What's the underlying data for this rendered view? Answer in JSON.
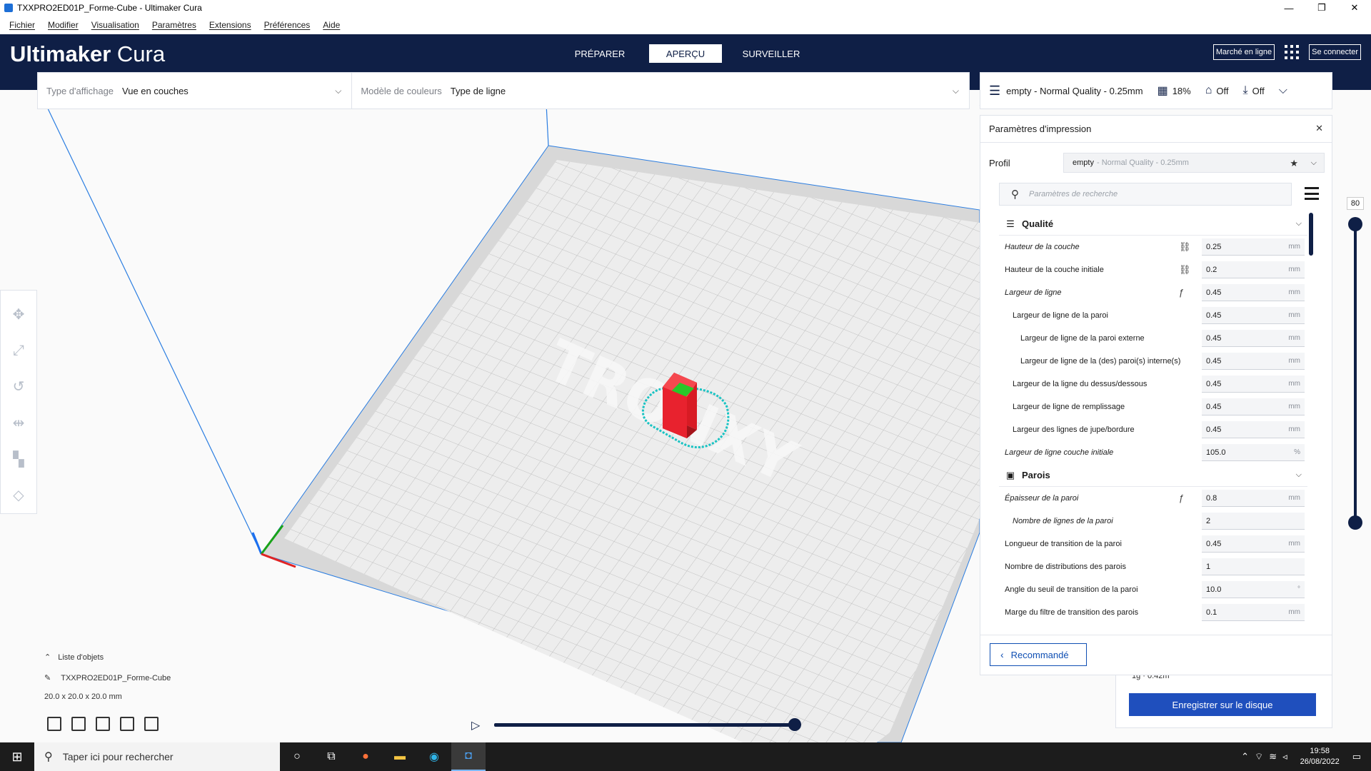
{
  "window": {
    "title": "TXXPRO2ED01P_Forme-Cube - Ultimaker Cura",
    "minimize": "—",
    "maximize": "❐",
    "close": "✕"
  },
  "menu": [
    "Fichier",
    "Modifier",
    "Visualisation",
    "Paramètres",
    "Extensions",
    "Préférences",
    "Aide"
  ],
  "header": {
    "logo_bold": "Ultimaker",
    "logo_light": "Cura",
    "stages": [
      "PRÉPARER",
      "APERÇU",
      "SURVEILLER"
    ],
    "active_stage": "APERÇU",
    "marketplace": "Marché en ligne",
    "signin": "Se connecter"
  },
  "view": {
    "type_label": "Type d'affichage",
    "type_value": "Vue en couches",
    "color_label": "Modèle de couleurs",
    "color_value": "Type de ligne"
  },
  "print_setup": {
    "profile": "empty - Normal Quality - 0.25mm",
    "infill": "18%",
    "support": "Off",
    "adhesion": "Off"
  },
  "panel": {
    "title": "Paramètres d'impression",
    "profile_label": "Profil",
    "profile_name": "empty",
    "profile_sub": "- Normal Quality - 0.25mm",
    "search_placeholder": "Paramètres de recherche",
    "recommended": "Recommandé"
  },
  "categories": [
    {
      "name": "Qualité",
      "icon": "quality-icon",
      "settings": [
        {
          "label": "Hauteur de la couche",
          "value": "0.25",
          "unit": "mm",
          "indent": 0,
          "italic": true,
          "icon": "link-icon"
        },
        {
          "label": "Hauteur de la couche initiale",
          "value": "0.2",
          "unit": "mm",
          "indent": 0,
          "italic": false,
          "icon": "link-icon"
        },
        {
          "label": "Largeur de ligne",
          "value": "0.45",
          "unit": "mm",
          "indent": 0,
          "italic": true,
          "icon": "function-icon"
        },
        {
          "label": "Largeur de ligne de la paroi",
          "value": "0.45",
          "unit": "mm",
          "indent": 1,
          "italic": false,
          "icon": ""
        },
        {
          "label": "Largeur de ligne de la paroi externe",
          "value": "0.45",
          "unit": "mm",
          "indent": 2,
          "italic": false,
          "icon": ""
        },
        {
          "label": "Largeur de ligne de la (des) paroi(s) interne(s)",
          "value": "0.45",
          "unit": "mm",
          "indent": 2,
          "italic": false,
          "icon": ""
        },
        {
          "label": "Largeur de la ligne du dessus/dessous",
          "value": "0.45",
          "unit": "mm",
          "indent": 1,
          "italic": false,
          "icon": ""
        },
        {
          "label": "Largeur de ligne de remplissage",
          "value": "0.45",
          "unit": "mm",
          "indent": 1,
          "italic": false,
          "icon": ""
        },
        {
          "label": "Largeur des lignes de jupe/bordure",
          "value": "0.45",
          "unit": "mm",
          "indent": 1,
          "italic": false,
          "icon": ""
        },
        {
          "label": "Largeur de ligne couche initiale",
          "value": "105.0",
          "unit": "%",
          "indent": 0,
          "italic": true,
          "icon": ""
        }
      ]
    },
    {
      "name": "Parois",
      "icon": "walls-icon",
      "settings": [
        {
          "label": "Épaisseur de la paroi",
          "value": "0.8",
          "unit": "mm",
          "indent": 0,
          "italic": true,
          "icon": "function-icon"
        },
        {
          "label": "Nombre de lignes de la paroi",
          "value": "2",
          "unit": "",
          "indent": 1,
          "italic": true,
          "icon": ""
        },
        {
          "label": "Longueur de transition de la paroi",
          "value": "0.45",
          "unit": "mm",
          "indent": 0,
          "italic": false,
          "icon": ""
        },
        {
          "label": "Nombre de distributions des parois",
          "value": "1",
          "unit": "",
          "indent": 0,
          "italic": false,
          "icon": ""
        },
        {
          "label": "Angle du seuil de transition de la paroi",
          "value": "10.0",
          "unit": "°",
          "indent": 0,
          "italic": false,
          "icon": ""
        },
        {
          "label": "Marge du filtre de transition des parois",
          "value": "0.1",
          "unit": "mm",
          "indent": 0,
          "italic": false,
          "icon": ""
        }
      ]
    }
  ],
  "objects": {
    "header": "Liste d'objets",
    "name": "TXXPRO2ED01P_Forme-Cube",
    "dims": "20.0 x 20.0 x 20.0 mm"
  },
  "layer_slider": {
    "max_label": "80"
  },
  "save": {
    "info": "1g · 0.42m",
    "button": "Enregistrer sur le disque"
  },
  "taskbar": {
    "search": "Taper ici pour rechercher",
    "time": "19:58",
    "date": "26/08/2022"
  },
  "colors": {
    "header": "#0f1f46",
    "accent": "#1f4fbd",
    "model": "#e8222e",
    "outline": "#19c3c3"
  }
}
